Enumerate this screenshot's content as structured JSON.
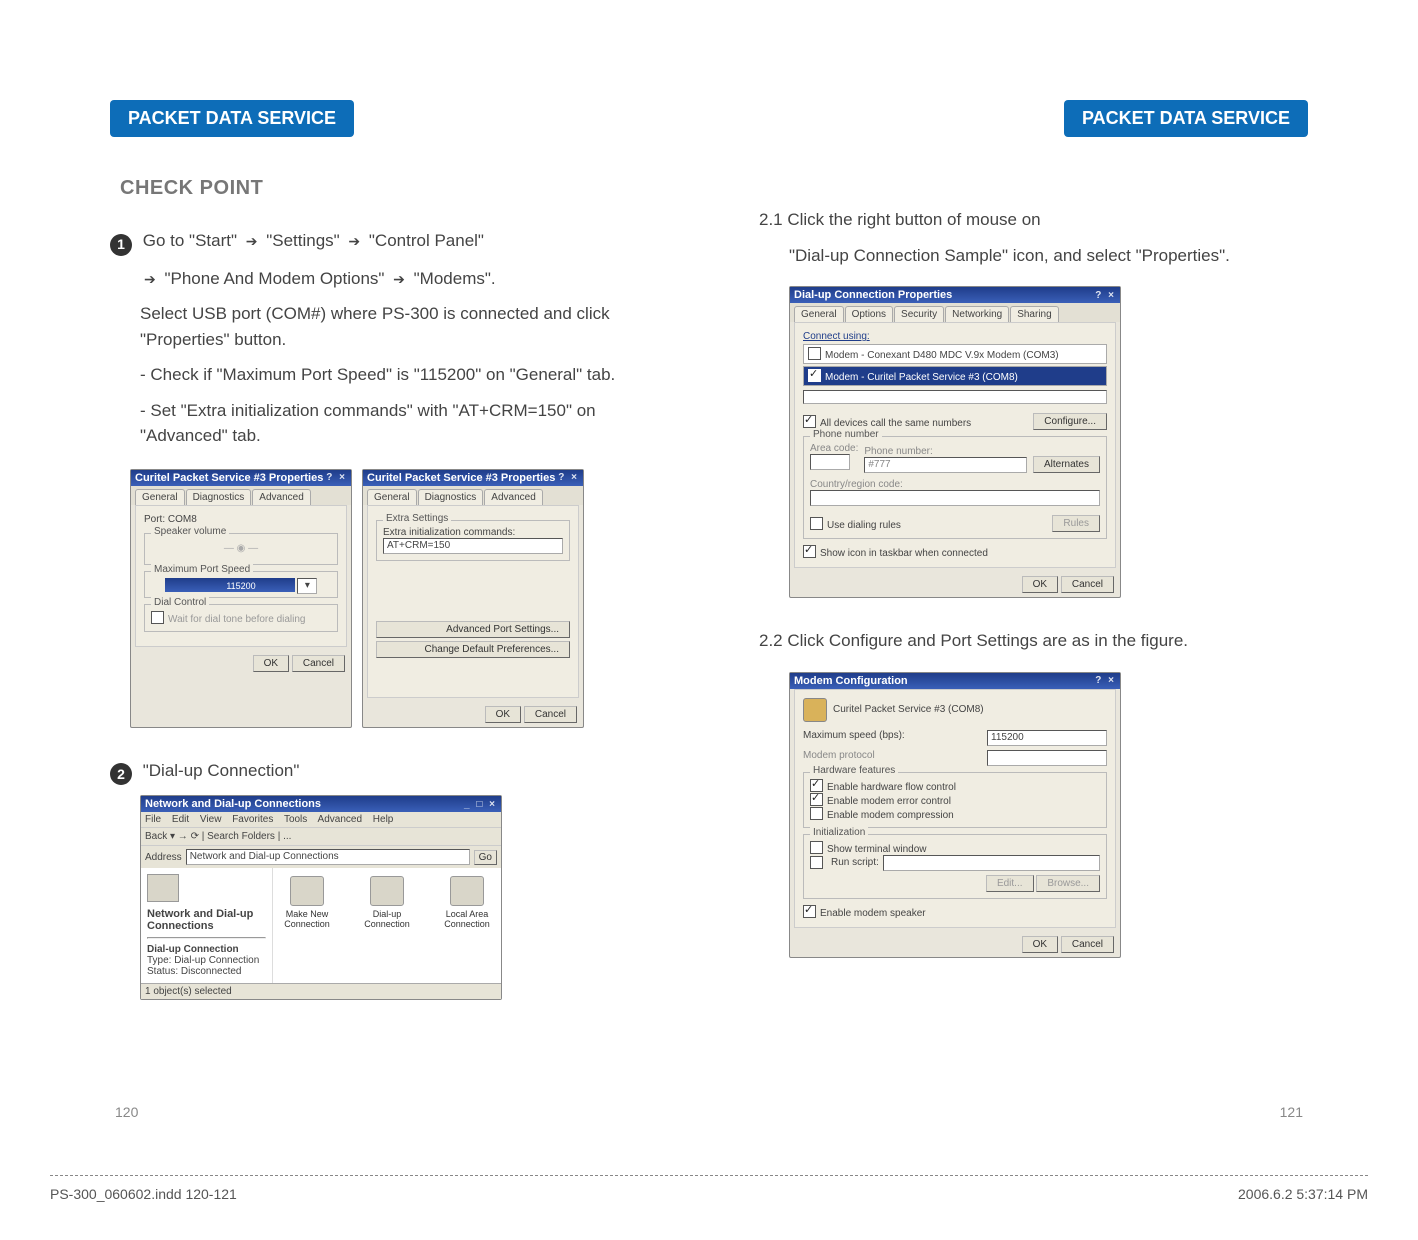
{
  "header": {
    "left_badge": "PACKET DATA SERVICE",
    "right_badge": "PACKET DATA SERVICE"
  },
  "left": {
    "section_title": "CHECK POINT",
    "step1": {
      "circle": "1",
      "line1_parts": [
        "Go to \"Start\" ",
        " \"Settings\" ",
        " \"Control Panel\""
      ],
      "line2_parts": [
        " \"Phone And Modem Options\" ",
        " \"Modems\"."
      ],
      "line3": "Select USB port (COM#) where PS-300 is connected and click \"Properties\" button.",
      "bullet1": "- Check if \"Maximum Port Speed\" is \"115200\" on \"General\" tab.",
      "bullet2": "- Set \"Extra initialization commands\" with \"AT+CRM=150\" on \"Advanced\" tab."
    },
    "win_props1": {
      "title": "Curitel Packet Service #3 Properties",
      "tabs": [
        "General",
        "Diagnostics",
        "Advanced"
      ],
      "port_label": "Port:  COM8",
      "speaker_label": "Speaker volume",
      "max_speed_label": "Maximum Port Speed",
      "max_speed_value": "115200",
      "dial_control_label": "Dial Control",
      "dial_control_check": "Wait for dial tone before dialing",
      "ok": "OK",
      "cancel": "Cancel"
    },
    "win_props2": {
      "title": "Curitel Packet Service #3 Properties",
      "tabs": [
        "General",
        "Diagnostics",
        "Advanced"
      ],
      "extra_label": "Extra Settings",
      "extra_cmd_label": "Extra initialization commands:",
      "extra_cmd_value": "AT+CRM=150",
      "adv_port": "Advanced Port Settings...",
      "change_def": "Change Default Preferences...",
      "ok": "OK",
      "cancel": "Cancel"
    },
    "step2": {
      "circle": "2",
      "text": " \"Dial-up Connection\""
    },
    "win_nd": {
      "title": "Network and Dial-up Connections",
      "menus": [
        "File",
        "Edit",
        "View",
        "Favorites",
        "Tools",
        "Advanced",
        "Help"
      ],
      "toolbar": "Back  ▾   →   ⟳   |  Search   Folders   | ...",
      "address_label": "Address",
      "address_value": "Network and Dial-up Connections",
      "go": "Go",
      "panel_title": "Network and Dial-up Connections",
      "icons": [
        "Make New Connection",
        "Dial-up Connection",
        "Local Area Connection"
      ],
      "detail_heading": "Dial-up Connection",
      "detail_type": "Type: Dial-up Connection",
      "detail_status": "Status: Disconnected",
      "status_bar": "1 object(s) selected"
    }
  },
  "right": {
    "step21_line1": "2.1 Click the right button of mouse on",
    "step21_line2": "\"Dial-up Connection Sample\" icon, and select \"Properties\".",
    "win_dialup": {
      "title": "Dial-up Connection Properties",
      "tabs": [
        "General",
        "Options",
        "Security",
        "Networking",
        "Sharing"
      ],
      "connect_label": "Connect using:",
      "modem1": "Modem - Conexant D480 MDC V.9x Modem (COM3)",
      "modem2": "Modem - Curitel Packet Service #3 (COM8)",
      "all_devices": "All devices call the same numbers",
      "configure": "Configure...",
      "phone_section": "Phone number",
      "area_label": "Area code:",
      "phone_label": "Phone number:",
      "phone_value": "#777",
      "alternates": "Alternates",
      "country_label": "Country/region code:",
      "use_dialing": "Use dialing rules",
      "rules": "Rules",
      "show_icon": "Show icon in taskbar when connected",
      "ok": "OK",
      "cancel": "Cancel"
    },
    "step22": "2.2 Click Configure and Port Settings are as in the figure.",
    "win_modemconf": {
      "title": "Modem Configuration",
      "subtitle": "Curitel Packet Service #3 (COM8)",
      "max_speed_label": "Maximum speed (bps):",
      "max_speed_value": "115200",
      "modem_proto_label": "Modem protocol",
      "hw_features": "Hardware features",
      "hw1": "Enable hardware flow control",
      "hw2": "Enable modem error control",
      "hw3": "Enable modem compression",
      "init_label": "Initialization",
      "term": "Show terminal window",
      "runscript": "Run script:",
      "edit": "Edit...",
      "browse": "Browse...",
      "speaker": "Enable modem speaker",
      "ok": "OK",
      "cancel": "Cancel"
    }
  },
  "pagenums": {
    "left": "120",
    "right": "121"
  },
  "footer": {
    "left": "PS-300_060602.indd   120-121",
    "right": "2006.6.2   5:37:14 PM"
  }
}
